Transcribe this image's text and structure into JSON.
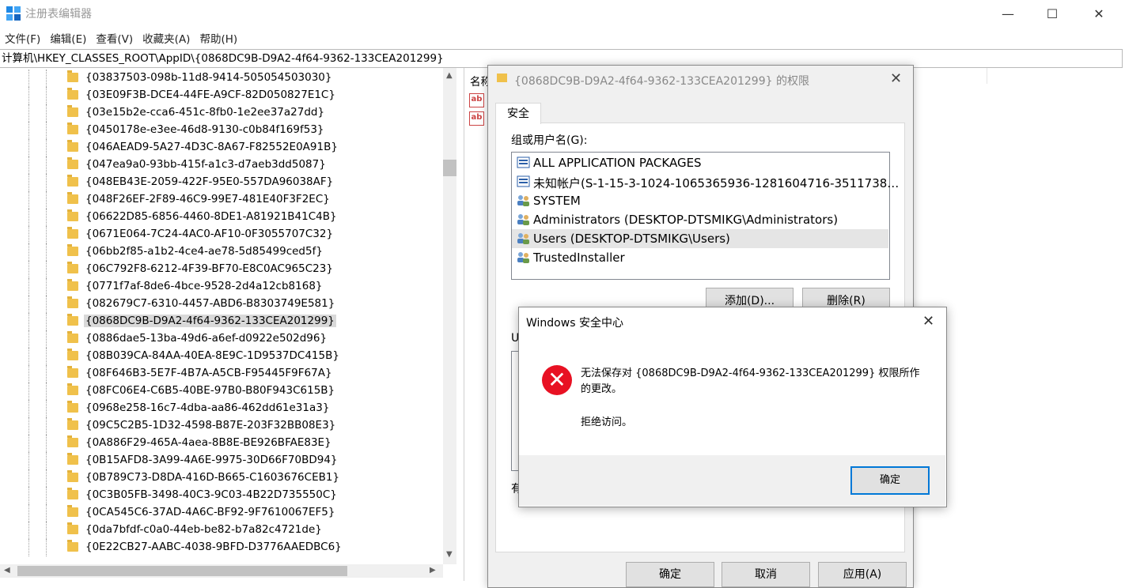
{
  "window": {
    "title": "注册表编辑器"
  },
  "menu": [
    "文件(F)",
    "编辑(E)",
    "查看(V)",
    "收藏夹(A)",
    "帮助(H)"
  ],
  "address": "计算机\\HKEY_CLASSES_ROOT\\AppID\\{0868DC9B-D9A2-4f64-9362-133CEA201299}",
  "tree": {
    "items": [
      "{03837503-098b-11d8-9414-505054503030}",
      "{03E09F3B-DCE4-44FE-A9CF-82D050827E1C}",
      "{03e15b2e-cca6-451c-8fb0-1e2ee37a27dd}",
      "{0450178e-e3ee-46d8-9130-c0b84f169f53}",
      "{046AEAD9-5A27-4D3C-8A67-F82552E0A91B}",
      "{047ea9a0-93bb-415f-a1c3-d7aeb3dd5087}",
      "{048EB43E-2059-422F-95E0-557DA96038AF}",
      "{048F26EF-2F89-46C9-99E7-481E40F3F2EC}",
      "{06622D85-6856-4460-8DE1-A81921B41C4B}",
      "{0671E064-7C24-4AC0-AF10-0F3055707C32}",
      "{06bb2f85-a1b2-4ce4-ae78-5d85499ced5f}",
      "{06C792F8-6212-4F39-BF70-E8C0AC965C23}",
      "{0771f7af-8de6-4bce-9528-2d4a12cb8168}",
      "{082679C7-6310-4457-ABD6-B8303749E581}",
      "{0868DC9B-D9A2-4f64-9362-133CEA201299}",
      "{0886dae5-13ba-49d6-a6ef-d0922e502d96}",
      "{08B039CA-84AA-40EA-8E9C-1D9537DC415B}",
      "{08F646B3-5E7F-4B7A-A5CB-F95445F9F67A}",
      "{08FC06E4-C6B5-40BE-97B0-B80F943C615B}",
      "{0968e258-16c7-4dba-aa86-462dd61e31a3}",
      "{09C5C2B5-1D32-4598-B87E-203F32BB08E3}",
      "{0A886F29-465A-4aea-8B8E-BE926BFAE83E}",
      "{0B15AFD8-3A99-4A6E-9975-30D66F70BD94}",
      "{0B789C73-D8DA-416D-B665-C1603676CEB1}",
      "{0C3B05FB-3498-40C3-9C03-4B22D735550C}",
      "{0CA545C6-37AD-4A6C-BF92-9F7610067EF5}",
      "{0da7bfdf-c0a0-44eb-be82-b7a82c4721de}",
      "{0E22CB27-AABC-4038-9BFD-D3776AAEDBC6}"
    ],
    "selected_index": 14
  },
  "right_pane": {
    "column_name": "名称"
  },
  "permissions_dialog": {
    "title": "{0868DC9B-D9A2-4f64-9362-133CEA201299} 的权限",
    "tab": "安全",
    "group_label": "组或用户名(G):",
    "users": [
      "ALL APPLICATION PACKAGES",
      "未知帐户(S-1-15-3-1024-1065365936-1281604716-3511738…",
      "SYSTEM",
      "Administrators (DESKTOP-DTSMIKG\\Administrators)",
      "Users (DESKTOP-DTSMIKG\\Users)",
      "TrustedInstaller"
    ],
    "highlighted_user_index": 4,
    "add_button": "添加(D)...",
    "remove_button": "删除(R)",
    "perm_label_partial": "U",
    "adv_label_partial": "有",
    "ok_button": "确定",
    "cancel_button": "取消",
    "apply_button": "应用(A)"
  },
  "error_dialog": {
    "title": "Windows 安全中心",
    "message": "无法保存对 {0868DC9B-D9A2-4f64-9362-133CEA201299} 权限所作的更改。",
    "detail": "拒绝访问。",
    "ok_button": "确定"
  },
  "colors": {
    "accent": "#0078d7",
    "error": "#e81123",
    "folder": "#f0c14b"
  }
}
